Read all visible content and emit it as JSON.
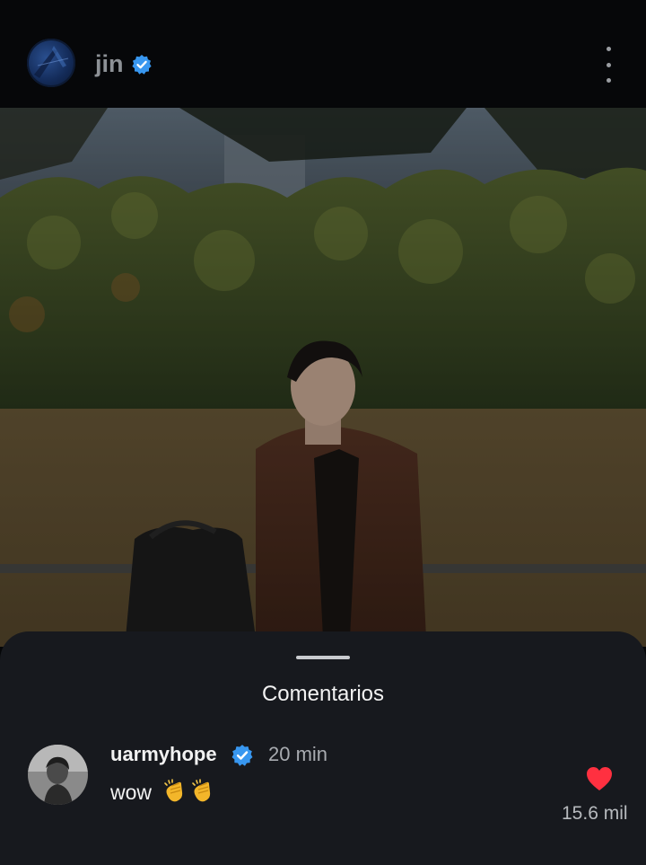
{
  "header": {
    "username": "jin",
    "verified": true,
    "more_icon": "more-vertical-icon"
  },
  "post": {
    "image_icon": "photo"
  },
  "comments_sheet": {
    "title": "Comentarios",
    "comments": [
      {
        "username": "uarmyhope",
        "verified": true,
        "time": "20 min",
        "text": "wow",
        "emoji": "👏👏",
        "likes": "15.6 mil",
        "liked": true
      }
    ]
  },
  "colors": {
    "verified": "#3897f0",
    "heart": "#ff3040",
    "sheet_bg": "#17191e"
  }
}
